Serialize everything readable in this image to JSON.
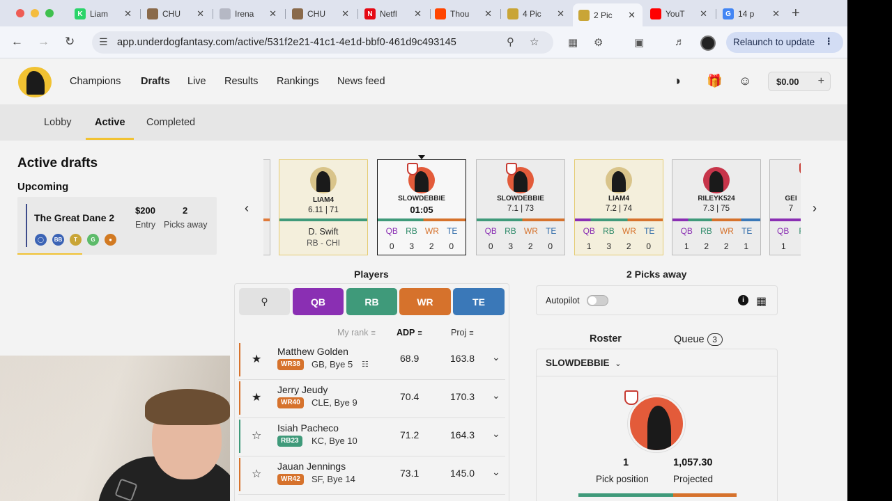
{
  "browser": {
    "tabs": [
      {
        "label": "Liam",
        "fav": "K",
        "fav_color": "#2bd46a"
      },
      {
        "label": "CHU",
        "fav": "",
        "fav_color": "#8a6a4a"
      },
      {
        "label": "Irena",
        "fav": "",
        "fav_color": "#b5b8c4"
      },
      {
        "label": "CHU",
        "fav": "",
        "fav_color": "#8a6a4a"
      },
      {
        "label": "Netfl",
        "fav": "N",
        "fav_color": "#e50914"
      },
      {
        "label": "Thou",
        "fav": "",
        "fav_color": "#ff4500"
      },
      {
        "label": "4 Pic",
        "fav": "",
        "fav_color": "#c9a536"
      },
      {
        "label": "2 Pic",
        "fav": "",
        "fav_color": "#c9a536"
      },
      {
        "label": "YouT",
        "fav": "",
        "fav_color": "#ff0000"
      },
      {
        "label": "14 p",
        "fav": "G",
        "fav_color": "#4285f4"
      }
    ],
    "url": "app.underdogfantasy.com/active/531f2e21-41c1-4e1d-bbf0-461d9c493145",
    "relaunch_label": "Relaunch to update"
  },
  "nav": {
    "items": [
      "Champions",
      "Drafts",
      "Live",
      "Results",
      "Rankings",
      "News feed"
    ],
    "balance": "$0.00"
  },
  "subtabs": [
    "Lobby",
    "Active",
    "Completed"
  ],
  "left": {
    "heading": "Active drafts",
    "upcoming": "Upcoming",
    "draft": {
      "name": "The Great Dane 2",
      "entry_value": "$200",
      "entry_label": "Entry",
      "picks_value": "2",
      "picks_label": "Picks away"
    }
  },
  "board": {
    "pos_labels": [
      "QB",
      "RB",
      "WR",
      "TE"
    ],
    "cards": [
      {
        "name": "LIAM4",
        "stat": "6.11 | 71",
        "player": "D. Swift",
        "sub": "RB - CHI",
        "type": "picked"
      },
      {
        "name": "SLOWDEBBIE",
        "stat": "01:05",
        "counts": [
          "0",
          "3",
          "2",
          "0"
        ],
        "type": "current"
      },
      {
        "name": "SLOWDEBBIE",
        "stat": "7.1 | 73",
        "counts": [
          "0",
          "3",
          "2",
          "0"
        ],
        "type": "user"
      },
      {
        "name": "LIAM4",
        "stat": "7.2 | 74",
        "counts": [
          "1",
          "3",
          "2",
          "0"
        ],
        "type": "gold"
      },
      {
        "name": "RILEYK524",
        "stat": "7.3 | 75",
        "counts": [
          "1",
          "2",
          "2",
          "1"
        ],
        "type": "other"
      },
      {
        "name": "GEI",
        "stat": "7",
        "counts": [
          "1",
          "",
          "",
          ""
        ],
        "type": "partial"
      }
    ]
  },
  "players": {
    "heading": "Players",
    "filters": [
      "QB",
      "RB",
      "WR",
      "TE"
    ],
    "columns": {
      "my_rank": "My rank",
      "adp": "ADP",
      "proj": "Proj"
    },
    "rows": [
      {
        "name": "Matthew Golden",
        "badge": "WR38",
        "team": "GB, Bye 5",
        "adp": "68.9",
        "proj": "163.8",
        "starred": true,
        "pos": "WR",
        "note": true
      },
      {
        "name": "Jerry Jeudy",
        "badge": "WR40",
        "team": "CLE, Bye 9",
        "adp": "70.4",
        "proj": "170.3",
        "starred": true,
        "pos": "WR",
        "note": false
      },
      {
        "name": "Isiah Pacheco",
        "badge": "RB23",
        "team": "KC, Bye 10",
        "adp": "71.2",
        "proj": "164.3",
        "starred": false,
        "pos": "RB",
        "note": false
      },
      {
        "name": "Jauan Jennings",
        "badge": "WR42",
        "team": "SF, Bye 14",
        "adp": "73.1",
        "proj": "145.0",
        "starred": false,
        "pos": "WR",
        "note": false
      }
    ]
  },
  "right": {
    "heading": "2 Picks away",
    "autopilot": "Autopilot",
    "roster_tab": "Roster",
    "queue_tab": "Queue",
    "queue_count": "3",
    "username": "SLOWDEBBIE",
    "pick_position_value": "1",
    "pick_position_label": "Pick position",
    "projected_value": "1,057.30",
    "projected_label": "Projected"
  },
  "colors": {
    "qb": "#8a2fb3",
    "rb": "#3f9a7a",
    "wr": "#d6722c",
    "te": "#3a78b8",
    "gold": "#f1c232",
    "orange_avatar": "#e35b3a",
    "red_avatar": "#c7354a",
    "tan_avatar": "#d9c48a"
  }
}
